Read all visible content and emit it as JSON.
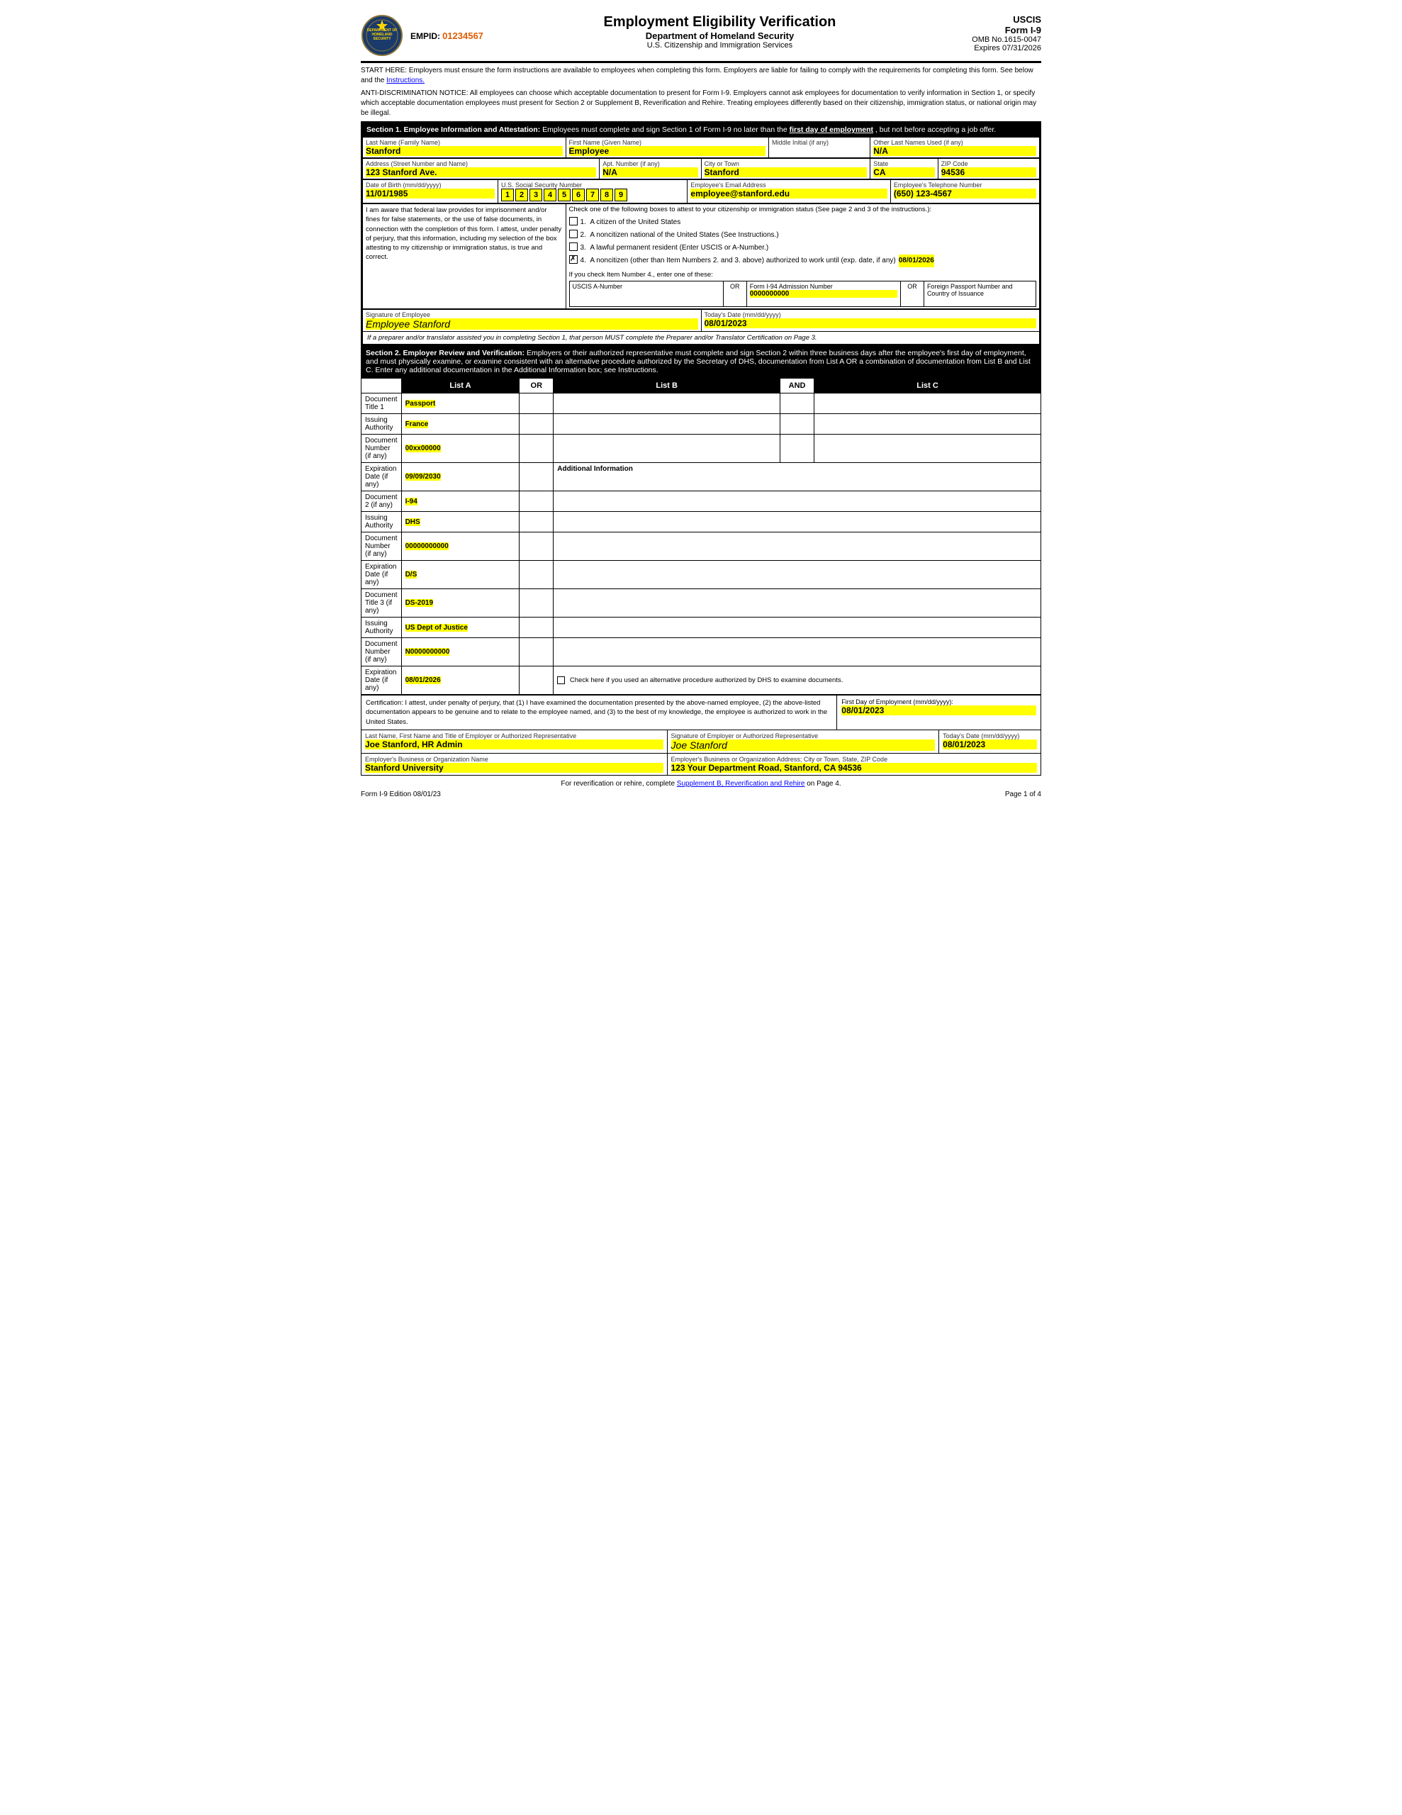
{
  "header": {
    "emp_id_label": "EMPID:",
    "emp_id_value": "01234567",
    "title": "Employment Eligibility Verification",
    "dept": "Department of Homeland Security",
    "agency": "U.S. Citizenship and Immigration Services",
    "form_agency": "USCIS",
    "form_name": "Form I-9",
    "omb": "OMB No.1615-0047",
    "expires": "Expires 07/31/2026"
  },
  "notice1": {
    "text": "START HERE: Employers must ensure the form instructions are available to employees when completing this form. Employers are liable for failing to comply with the requirements for completing this form. See below and the ",
    "link": "Instructions."
  },
  "notice2": {
    "text": "ANTI-DISCRIMINATION NOTICE: All employees can choose which acceptable documentation to present for Form I-9. Employers cannot ask employees for documentation to verify information in Section 1, or specify which acceptable documentation employees must present for Section 2 or Supplement B, Reverification and Rehire. Treating employees differently based on their citizenship, immigration status, or national origin may be illegal."
  },
  "section1": {
    "header": "Section 1. Employee Information and Attestation:",
    "header_rest": " Employees must complete and sign Section 1 of Form I-9 no later than the ",
    "header_bold": "first day of employment",
    "header_end": ", but not before accepting a job offer.",
    "last_name_label": "Last Name (Family Name)",
    "last_name_value": "Stanford",
    "first_name_label": "First Name (Given Name)",
    "first_name_value": "Employee",
    "middle_initial_label": "Middle Initial (if any)",
    "middle_initial_value": "",
    "other_names_label": "Other Last Names Used (if any)",
    "other_names_value": "N/A",
    "address_label": "Address (Street Number and Name)",
    "address_value": "123 Stanford Ave.",
    "apt_label": "Apt. Number (if any)",
    "apt_value": "N/A",
    "city_label": "City or Town",
    "city_value": "Stanford",
    "state_label": "State",
    "state_value": "CA",
    "zip_label": "ZIP Code",
    "zip_value": "94536",
    "dob_label": "Date of Birth (mm/dd/yyyy)",
    "dob_value": "11/01/1985",
    "ssn_label": "U.S. Social Security Number",
    "ssn_digits": [
      "1",
      "2",
      "3",
      "4",
      "5",
      "6",
      "7",
      "8",
      "9"
    ],
    "email_label": "Employee's Email Address",
    "email_value": "employee@stanford.edu",
    "phone_label": "Employee's Telephone Number",
    "phone_value": "(650) 123-4567",
    "awareness_text": "I am aware that federal law provides for imprisonment and/or fines for false statements, or the use of false documents, in connection with the completion of this form. I attest, under penalty of perjury, that this information, including my selection of the box attesting to my citizenship or immigration status, is true and correct.",
    "citizenship_options": [
      {
        "num": "1.",
        "text": "A citizen of the United States",
        "checked": false
      },
      {
        "num": "2.",
        "text": "A noncitizen national of the United States (See Instructions.)",
        "checked": false
      },
      {
        "num": "3.",
        "text": "A lawful permanent resident (Enter USCIS or A-Number.)",
        "checked": false
      },
      {
        "num": "4.",
        "text": "A noncitizen (other than Item Numbers 2. and 3. above) authorized to work until (exp. date, if any)",
        "checked": true
      }
    ],
    "item4_date": "08/01/2026",
    "item4_note": "If you check Item Number 4., enter one of these:",
    "uscis_label": "USCIS A-Number",
    "uscis_value": "",
    "i94_label": "Form I-94 Admission Number",
    "i94_value": "0000000000",
    "passport_label": "Foreign Passport Number and Country of Issuance",
    "passport_value": "",
    "sig_label": "Signature of Employee",
    "sig_value": "Employee Stanford",
    "sig_date_label": "Today's Date (mm/dd/yyyy)",
    "sig_date_value": "08/01/2023",
    "preparer_notice": "If a preparer and/or translator assisted you in completing Section 1, that person MUST complete the Preparer and/or Translator Certification on Page 3."
  },
  "section2": {
    "header": "Section 2. Employer Review and Verification:",
    "header_rest": " Employers or their authorized representative must complete and sign Section 2 within three business days after the employee's first day of employment, and must physically examine, or examine consistent with an alternative procedure authorized by the Secretary of DHS, documentation from List A OR a combination of documentation from List B and List C. Enter any additional documentation in the Additional Information box; see Instructions.",
    "list_a_header": "List A",
    "list_b_header": "List B",
    "list_c_header": "List C",
    "or_label": "OR",
    "and_label": "AND",
    "rows": [
      {
        "label": "Document Title 1",
        "list_a": "Passport",
        "list_b": "",
        "list_c": ""
      },
      {
        "label": "Issuing Authority",
        "list_a": "France",
        "list_b": "",
        "list_c": ""
      },
      {
        "label": "Document Number (if any)",
        "list_a": "00xx00000",
        "list_b": "",
        "list_c": ""
      },
      {
        "label": "Expiration Date (if any)",
        "list_a": "09/09/2030",
        "list_b": "",
        "list_c": ""
      }
    ],
    "doc2_label": "Document 2 (if any)",
    "doc2_value": "I-94",
    "issuing2_label": "Issuing Authority",
    "issuing2_value": "DHS",
    "docnum2_label": "Document Number (if any)",
    "docnum2_value": "00000000000",
    "expdate2_label": "Expiration Date (if any)",
    "expdate2_value": "D/S",
    "doc3_label": "Document Title 3 (if any)",
    "doc3_value": "DS-2019",
    "issuing3_label": "Issuing Authority",
    "issuing3_value": "US Dept of Justice",
    "docnum3_label": "Document Number (if any)",
    "docnum3_value": "N0000000000",
    "expdate3_label": "Expiration Date (if any)",
    "expdate3_value": "08/01/2026",
    "additional_info_label": "Additional Information",
    "alt_procedure_label": "Check here if you used an alternative procedure authorized by DHS to examine documents.",
    "cert_text": "Certification: I attest, under penalty of perjury, that (1) I have examined the documentation presented by the above-named employee, (2) the above-listed documentation appears to be genuine and to relate to the employee named, and (3) to the best of my knowledge, the employee is authorized to work in the United States.",
    "first_day_label": "First Day of Employment (mm/dd/yyyy):",
    "first_day_value": "08/01/2023",
    "employer_name_label": "Last Name, First Name and Title of Employer or Authorized Representative",
    "employer_name_value": "Joe Stanford, HR Admin",
    "employer_sig_label": "Signature of Employer or Authorized Representative",
    "employer_sig_value": "Joe Stanford",
    "employer_date_label": "Today's Date (mm/dd/yyyy)",
    "employer_date_value": "08/01/2023",
    "org_name_label": "Employer's Business or Organization Name",
    "org_name_value": "Stanford University",
    "org_address_label": "Employer's Business or Organization Address; City or Town, State, ZIP Code",
    "org_address_value": "123 Your Department Road, Stanford, CA 94536"
  },
  "footer": {
    "reverif_text": "For reverification or rehire, complete ",
    "reverif_link": "Supplement B, Reverification and Rehire",
    "reverif_end": " on Page 4.",
    "edition_label": "Form I-9 Edition 08/01/23",
    "page_label": "Page 1 of 4"
  }
}
